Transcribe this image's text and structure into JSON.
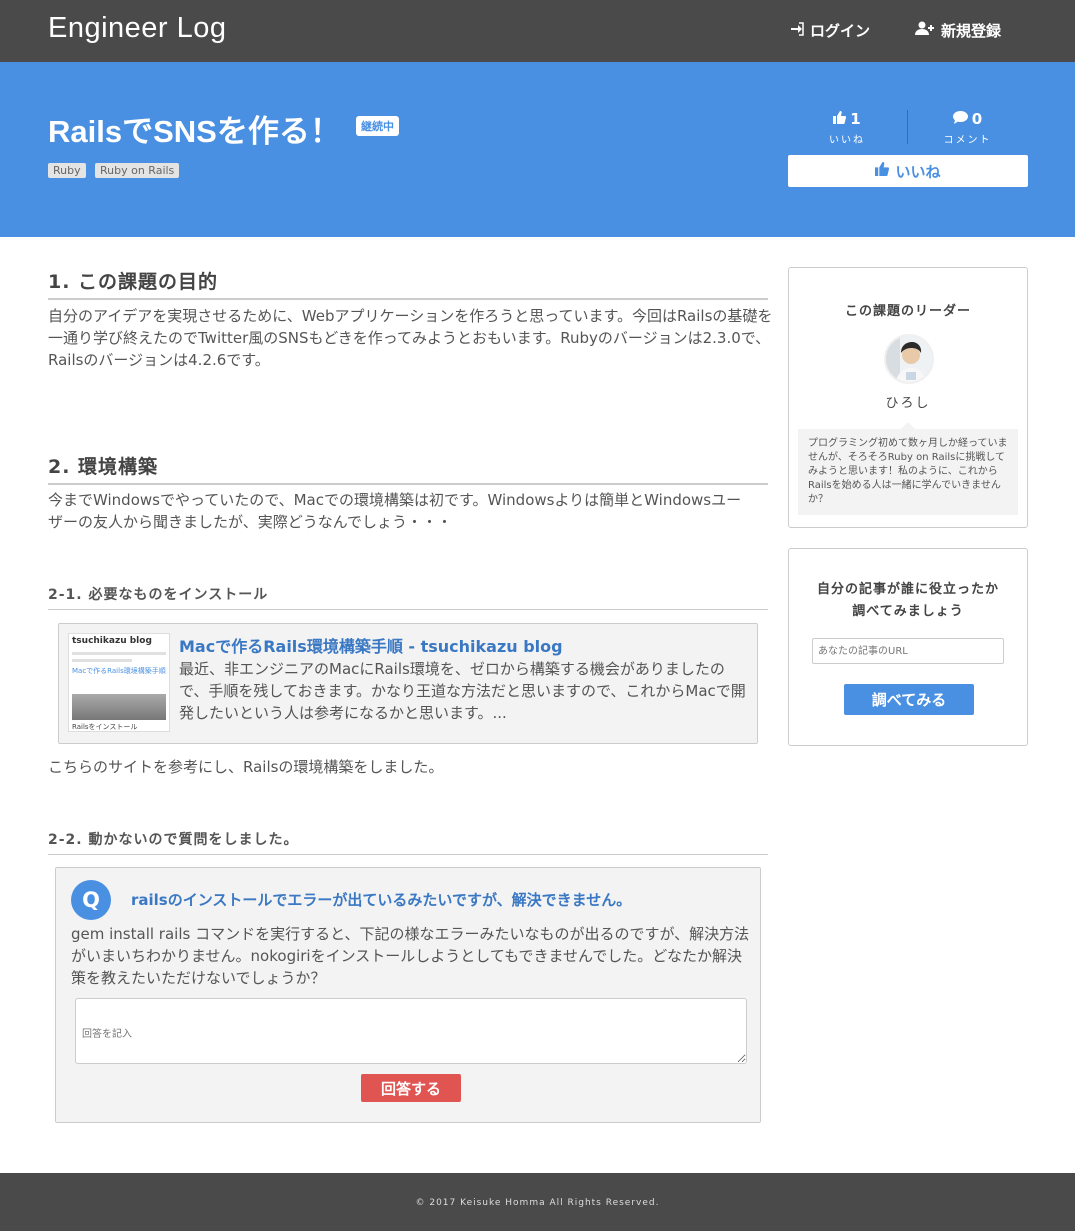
{
  "header": {
    "logo": "Engineer Log",
    "login_label": "ログイン",
    "signup_label": "新規登録",
    "login_icon": "sign-in-icon",
    "signup_icon": "user-plus-icon"
  },
  "hero": {
    "title": "RailsでSNSを作る！",
    "status": "継続中",
    "tags": [
      "Ruby",
      "Ruby on Rails"
    ],
    "likes_count": "1",
    "likes_label": "いいね",
    "comments_count": "0",
    "comments_label": "コメント",
    "like_button_label": "いいね",
    "colors": {
      "hero_bg": "#4a90e2",
      "header_bg": "#4a4a4a"
    }
  },
  "article": {
    "sections": [
      {
        "heading": "1. この課題の目的",
        "body": "自分のアイデアを実現させるために、Webアプリケーションを作ろうと思っています。今回はRailsの基礎を一通り学び終えたのでTwitter風のSNSもどきを作ってみようとおもいます。Rubyのバージョンは2.3.0で、Railsのバージョンは4.2.6です。"
      },
      {
        "heading": "2. 環境構築",
        "body": "今までWindowsでやっていたので、Macでの環境構築は初です。Windowsよりは簡単とWindowsユーザーの友人から聞きましたが、実際どうなんでしょう・・・"
      }
    ],
    "sub1": {
      "heading": "2-1. 必要なものをインストール",
      "link_card": {
        "thumb_title": "tsuchikazu blog",
        "thumb_caption": "Macで作るRails環境構築手順",
        "thumb_footer": "Railsをインストール",
        "title": "Macで作るRails環境構築手順 - tsuchikazu blog",
        "description": "最近、非エンジニアのMacにRails環境を、ゼロから構築する機会がありましたので、手順を残しておきます。かなり王道な方法だと思いますので、これからMacで開発したいという人は参考になるかと思います。..."
      },
      "after_text": "こちらのサイトを参考にし、Railsの環境構築をしました。"
    },
    "sub2": {
      "heading": "2-2. 動かないので質問をしました。",
      "question": {
        "badge": "Q",
        "title": "railsのインストールでエラーが出ているみたいですが、解決できません。",
        "body": "gem install rails コマンドを実行すると、下記の様なエラーみたいなものが出るのですが、解決方法がいまいちわかりません。nokogiriをインストールしようとしてもできませんでした。どなたか解決策を教えたいただけないでしょうか？",
        "answer_placeholder": "回答を記入",
        "answer_button": "回答する"
      }
    }
  },
  "sidebar": {
    "leader": {
      "heading": "この課題のリーダー",
      "name": "ひろし",
      "bio": "プログラミング初めて数ヶ月しか経っていませんが、そろそろRuby on Railsに挑戦してみようと思います！私のように、これからRailsを始める人は一緒に学んでいきませんか？"
    },
    "search": {
      "heading_line1": "自分の記事が誰に役立ったか",
      "heading_line2": "調べてみましょう",
      "url_placeholder": "あなたの記事のURL",
      "button_label": "調べてみる"
    }
  },
  "footer": {
    "copyright": "© 2017 Keisuke Homma All Rights Reserved."
  }
}
